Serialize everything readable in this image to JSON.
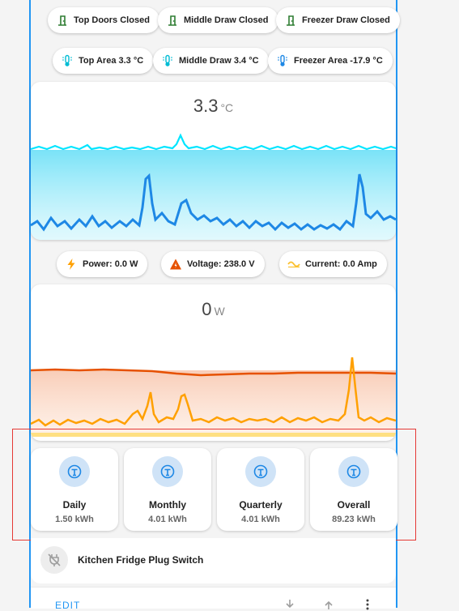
{
  "status_chips": [
    {
      "label": "Top Doors Closed",
      "icon": "door-closed-icon"
    },
    {
      "label": "Middle Draw Closed",
      "icon": "door-closed-icon"
    },
    {
      "label": "Freezer Draw Closed",
      "icon": "door-closed-icon"
    }
  ],
  "temp_chips": [
    {
      "label": "Top Area 3.3 °C",
      "icon": "thermometer-icon"
    },
    {
      "label": "Middle Draw 3.4 °C",
      "icon": "thermometer-icon"
    },
    {
      "label": "Freezer Area -17.9 °C",
      "icon": "thermometer-icon"
    }
  ],
  "temp_card": {
    "value": "3.3",
    "unit": "°C"
  },
  "power_chips": [
    {
      "label": "Power: 0.0 W",
      "icon": "flash-icon"
    },
    {
      "label": "Voltage: 238.0 V",
      "icon": "warning-flash-icon"
    },
    {
      "label": "Current: 0.0 Amp",
      "icon": "current-ac-icon"
    }
  ],
  "power_card": {
    "value": "0",
    "unit": "W"
  },
  "energy": [
    {
      "label": "Daily",
      "value": "1.50 kWh"
    },
    {
      "label": "Monthly",
      "value": "4.01 kWh"
    },
    {
      "label": "Quarterly",
      "value": "4.01 kWh"
    },
    {
      "label": "Overall",
      "value": "89.23 kWh"
    }
  ],
  "switch": {
    "label": "Kitchen Fridge Plug Switch",
    "icon": "power-plug-off-icon"
  },
  "bottom": {
    "edit_label": "EDIT"
  },
  "colors": {
    "accent": "#2196f3",
    "temp_line_top": "#00e5ff",
    "temp_line_low": "#1e88e5",
    "power_line_voltage": "#e65100",
    "power_line_power": "#ffa000",
    "highlight_box": "#e53935"
  }
}
